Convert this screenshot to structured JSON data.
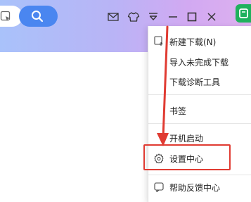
{
  "toolbar": {
    "search_placeholder": "",
    "icons": [
      "bookmark-list-icon",
      "search-icon",
      "mail-icon",
      "skin-icon",
      "menu-icon",
      "minimize-icon",
      "maximize-icon",
      "close-icon",
      "app-badge-icon"
    ]
  },
  "menu": {
    "items": [
      {
        "label": "新建下载(N)",
        "icon": "new-download-icon"
      },
      {
        "label": "导入未完成下载",
        "icon": ""
      },
      {
        "label": "下载诊断工具",
        "icon": ""
      },
      {
        "label": "书签",
        "icon": ""
      },
      {
        "label": "开机启动",
        "icon": ""
      },
      {
        "label": "设置中心",
        "icon": "gear-icon"
      },
      {
        "label": "帮助反馈中心",
        "icon": "help-icon"
      }
    ]
  },
  "annotation": {
    "highlight_color": "#e03b32",
    "target": "设置中心"
  },
  "colors": {
    "search_button": "#4a86f0",
    "badge": "#1fb15d"
  }
}
